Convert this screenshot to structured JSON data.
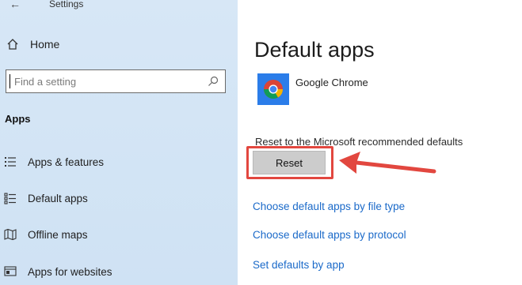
{
  "window": {
    "title": "Settings",
    "back_icon": "back-arrow-icon"
  },
  "sidebar": {
    "home_label": "Home",
    "search": {
      "placeholder": "Find a setting"
    },
    "section_title": "Apps",
    "items": [
      {
        "label": "Apps & features",
        "icon": "apps-features-icon"
      },
      {
        "label": "Default apps",
        "icon": "default-apps-icon"
      },
      {
        "label": "Offline maps",
        "icon": "map-icon"
      },
      {
        "label": "Apps for websites",
        "icon": "apps-websites-icon"
      }
    ]
  },
  "main": {
    "title": "Default apps",
    "app_name": "Google Chrome",
    "reset_text": "Reset to the Microsoft recommended defaults",
    "reset_button": "Reset",
    "links": [
      "Choose default apps by file type",
      "Choose default apps by protocol",
      "Set defaults by app"
    ]
  },
  "colors": {
    "sidebar_bg": "#d4e6f5",
    "link": "#1b6ac9",
    "highlight": "#e2473f"
  }
}
